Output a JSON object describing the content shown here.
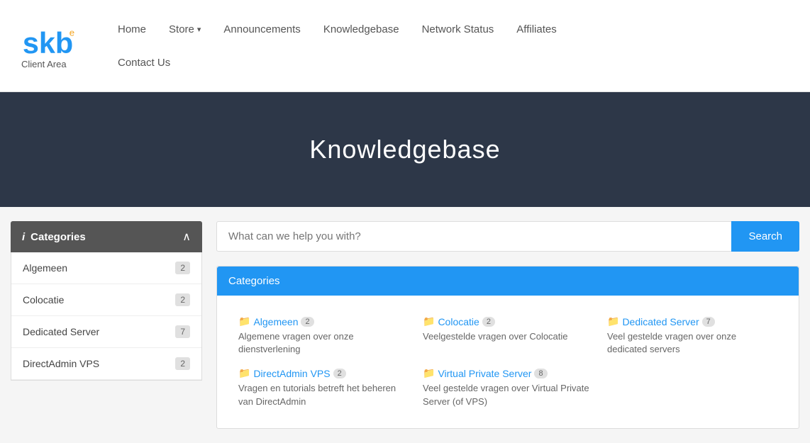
{
  "header": {
    "logo_text": "skb",
    "logo_superscript": "e",
    "client_area_label": "Client Area",
    "nav_items": [
      {
        "label": "Home",
        "name": "home"
      },
      {
        "label": "Store",
        "name": "store",
        "dropdown": true
      },
      {
        "label": "Announcements",
        "name": "announcements"
      },
      {
        "label": "Knowledgebase",
        "name": "knowledgebase"
      },
      {
        "label": "Network Status",
        "name": "network-status"
      },
      {
        "label": "Affiliates",
        "name": "affiliates"
      }
    ],
    "nav_bottom_items": [
      {
        "label": "Contact Us",
        "name": "contact-us"
      }
    ]
  },
  "hero": {
    "title": "Knowledgebase"
  },
  "sidebar": {
    "title": "Categories",
    "items": [
      {
        "label": "Algemeen",
        "count": "2"
      },
      {
        "label": "Colocatie",
        "count": "2"
      },
      {
        "label": "Dedicated Server",
        "count": "7"
      },
      {
        "label": "DirectAdmin VPS",
        "count": "2"
      }
    ]
  },
  "search": {
    "placeholder": "What can we help you with?",
    "button_label": "Search"
  },
  "categories": {
    "header_label": "Categories",
    "items": [
      {
        "name": "category-algemeen",
        "title": "Algemeen",
        "count": "2",
        "description": "Algemene vragen over onze dienstverlening"
      },
      {
        "name": "category-colocatie",
        "title": "Colocatie",
        "count": "2",
        "description": "Veelgestelde vragen over Colocatie"
      },
      {
        "name": "category-dedicated-server",
        "title": "Dedicated Server",
        "count": "7",
        "description": "Veel gestelde vragen over onze dedicated servers"
      },
      {
        "name": "category-directadmin-vps",
        "title": "DirectAdmin VPS",
        "count": "2",
        "description": "Vragen en tutorials betreft het beheren van DirectAdmin"
      },
      {
        "name": "category-virtual-private-server",
        "title": "Virtual Private Server",
        "count": "8",
        "description": "Veel gestelde vragen over Virtual Private Server (of VPS)"
      }
    ]
  }
}
